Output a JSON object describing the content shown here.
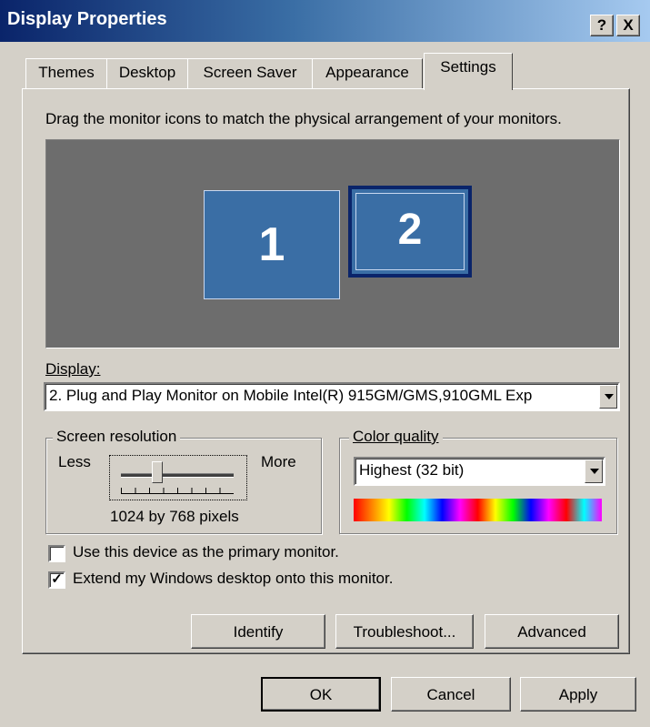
{
  "window": {
    "title": "Display Properties",
    "help_button": "?",
    "close_button": "X"
  },
  "tabs": [
    {
      "label": "Themes",
      "active": false
    },
    {
      "label": "Desktop",
      "active": false
    },
    {
      "label": "Screen Saver",
      "active": false
    },
    {
      "label": "Appearance",
      "active": false
    },
    {
      "label": "Settings",
      "active": true
    }
  ],
  "settings": {
    "instructions": "Drag the monitor icons to match the physical arrangement of your monitors.",
    "monitors": [
      {
        "number": "1"
      },
      {
        "number": "2"
      }
    ],
    "display_label": "Display:",
    "display_value": "2. Plug and Play Monitor on Mobile Intel(R) 915GM/GMS,910GML Exp",
    "screen_resolution": {
      "legend": "Screen resolution",
      "less": "Less",
      "more": "More",
      "value": "1024 by 768 pixels"
    },
    "color_quality": {
      "legend": "Color quality",
      "value": "Highest (32 bit)"
    },
    "primary_monitor_checkbox": {
      "label": "Use this device as the primary monitor.",
      "checked": false
    },
    "extend_desktop_checkbox": {
      "label": "Extend my Windows desktop onto this monitor.",
      "checked": true,
      "mark": "✓"
    },
    "buttons": {
      "identify": "Identify",
      "troubleshoot": "Troubleshoot...",
      "advanced": "Advanced"
    }
  },
  "dialog_buttons": {
    "ok": "OK",
    "cancel": "Cancel",
    "apply": "Apply"
  },
  "colors": {
    "titlebar_start": "#0a246a",
    "face": "#d4d0c8",
    "monitor_blue": "#3a6ea5",
    "monitor_area": "#6d6d6d"
  }
}
